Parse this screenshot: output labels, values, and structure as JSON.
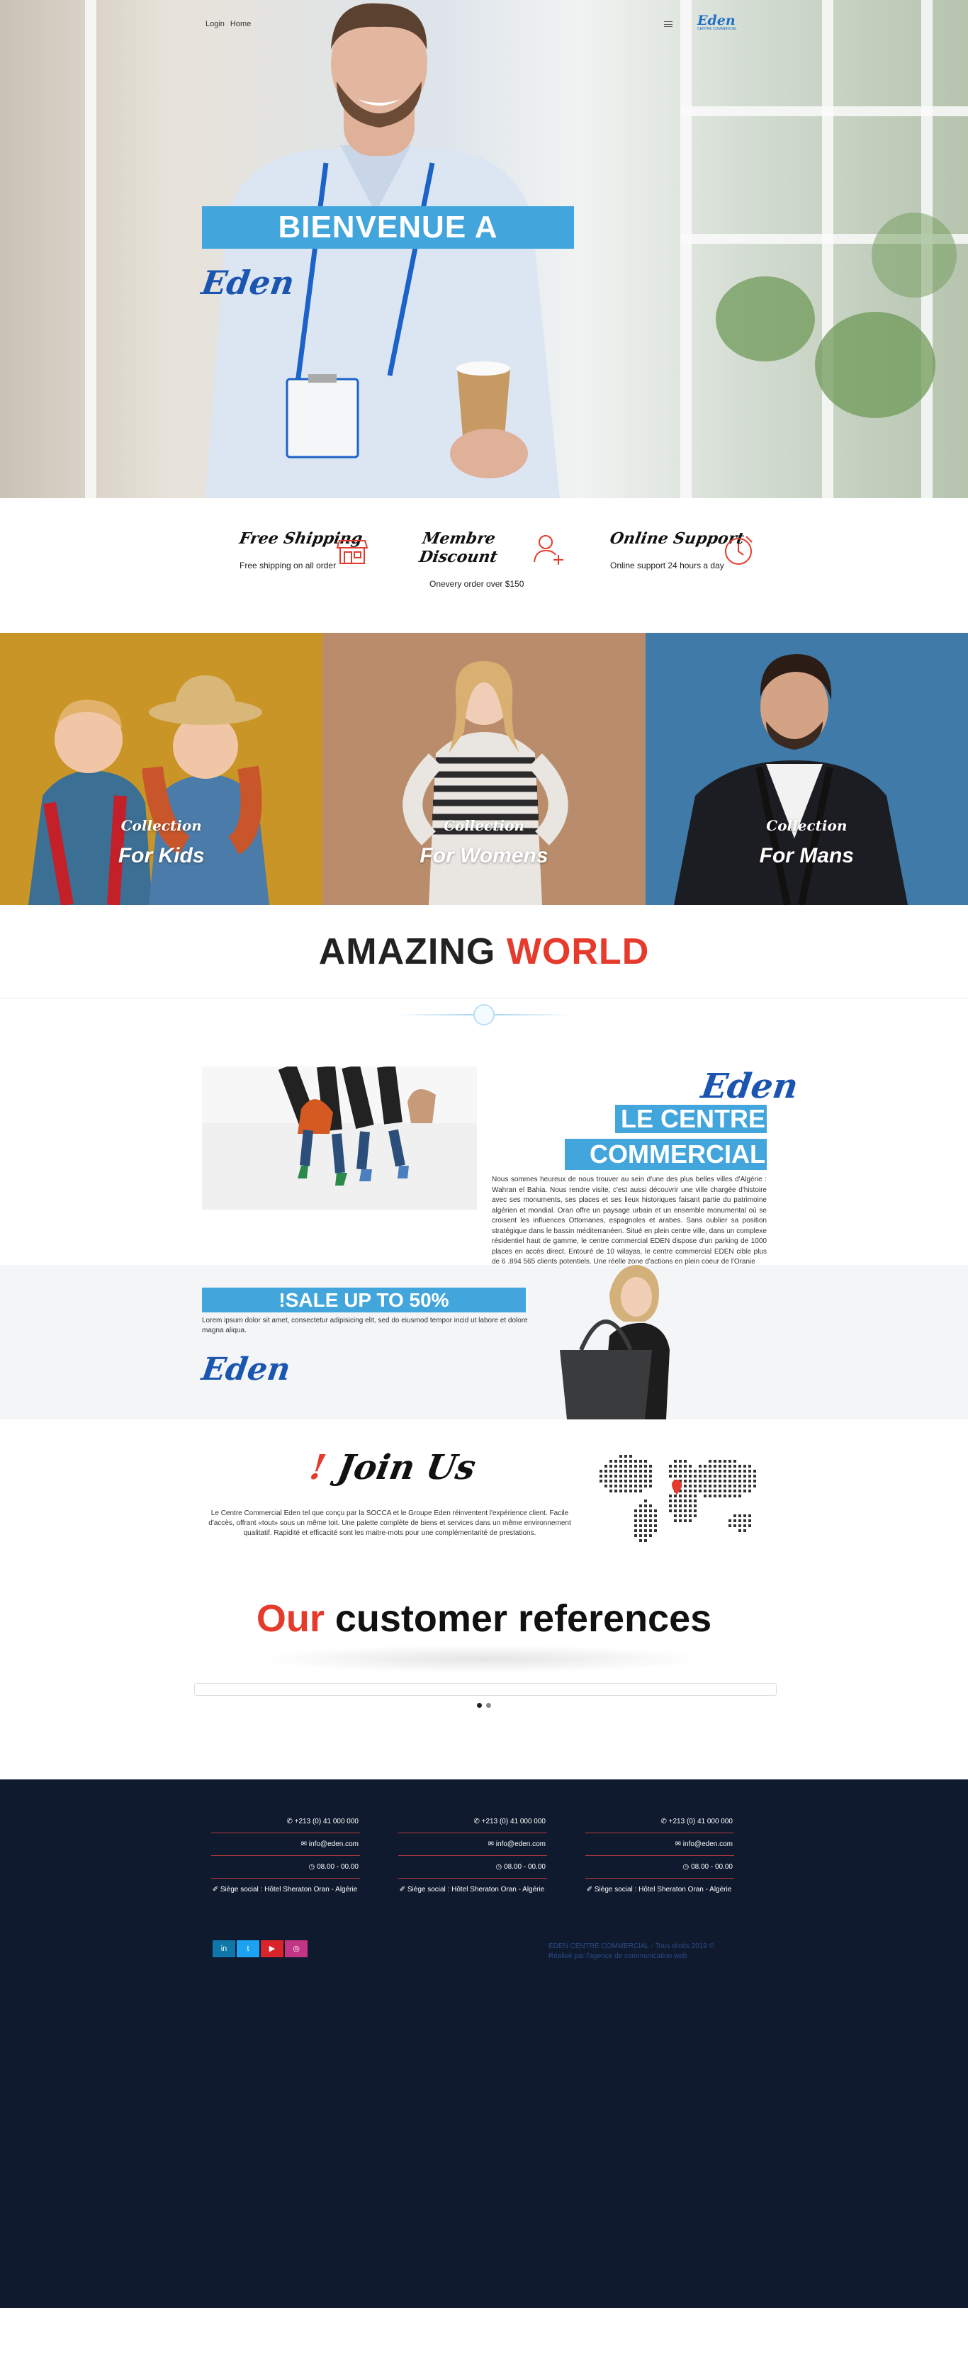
{
  "nav": {
    "login": "Login",
    "home": "Home",
    "logo_word": "Eden",
    "logo_tagline": "CENTRE COMMERCIAL"
  },
  "hero": {
    "banner": "BIENVENUE A",
    "brand": "Eden"
  },
  "features": [
    {
      "title": "Free Shipping",
      "desc": "Free shipping on all order",
      "icon": "shop-icon"
    },
    {
      "title": "Membre Discount",
      "desc": "Onevery order over $150",
      "icon": "user-plus-icon"
    },
    {
      "title": "Online Support",
      "desc": "Online support 24 hours a day",
      "icon": "clock-icon"
    }
  ],
  "collections": [
    {
      "label": "Collection",
      "name": "For Kids",
      "color": "#c99527"
    },
    {
      "label": "Collection",
      "name": "For Womens",
      "color": "#b98d6b"
    },
    {
      "label": "Collection",
      "name": "For Mans",
      "color": "#3f7aa8"
    }
  ],
  "amazing": {
    "part1": "AMAZING",
    "part2": "WORLD"
  },
  "about": {
    "brand": "Eden",
    "line1": "LE CENTRE",
    "line2": "COMMERCIAL",
    "text": "Nous sommes heureux de nous trouver au sein d'une des plus belles villes d'Algérie : Wahran el Bahia. Nous rendre visite, c'est aussi découvrir une ville chargée d'histoire avec ses monuments, ses places et ses lieux historiques faisant partie du patrimoine algérien et mondial. Oran offre un paysage urbain et un ensemble monumental où se croisent les influences Ottomanes, espagnoles et arabes. Sans oublier sa position stratégique dans le bassin méditerranéen. Situé en plein centre ville, dans un complexe résidentiel haut de gamme, le centre commercial EDEN dispose d'un parking de 1000 places en accès direct. Entouré de 10 wilayas, le centre commercial EDEN cible plus de 6 .894 565 clients potentiels. Une réelle zone d'actions en plein coeur de l'Oranie"
  },
  "sale": {
    "banner": "!SALE UP TO 50%",
    "text": "Lorem ipsum dolor sit amet, consectetur adipisicing elit, sed do eiusmod tempor incid ut labore et dolore magna aliqua.",
    "brand": "Eden"
  },
  "join": {
    "mark": "!",
    "title": "Join Us",
    "text": "Le Centre Commercial Eden tel que conçu par la SOCCA et le Groupe Eden réinventent l'expérience client. Facile d'accès, offrant «tout» sous un même toit. Une palette complète de biens et services dans un même environnement qualitatif. Rapidité et efficacité sont les maitre-mots pour une complémentarité de prestations."
  },
  "refs": {
    "part1": "Our",
    "part2": "customer references"
  },
  "footer": {
    "columns": [
      {
        "phone": "+213 (0) 41 000 000",
        "email": "info@eden.com",
        "hours": "08.00 - 00.00",
        "address": "Siège social : Hôtel Sheraton Oran - Algérie"
      },
      {
        "phone": "+213 (0) 41 000 000",
        "email": "info@eden.com",
        "hours": "08.00 - 00.00",
        "address": "Siège social : Hôtel Sheraton Oran - Algérie"
      },
      {
        "phone": "+213 (0) 41 000 000",
        "email": "info@eden.com",
        "hours": "08.00 - 00.00",
        "address": "Siège social : Hôtel Sheraton Oran - Algérie"
      }
    ],
    "social": [
      {
        "icon": "linkedin-icon",
        "glyph": "in",
        "color": "#0e76a8"
      },
      {
        "icon": "twitter-icon",
        "glyph": "t",
        "color": "#1da1f2"
      },
      {
        "icon": "youtube-icon",
        "glyph": "▶",
        "color": "#d9252a"
      },
      {
        "icon": "instagram-icon",
        "glyph": "◎",
        "color": "#c13584"
      }
    ],
    "copyright": "EDEN CENTRE COMMERCIAL - Tous droits 2019 ©",
    "credit": "Réalisé par l'agence de communication web"
  },
  "colors": {
    "accent": "#42a6dd",
    "brand_blue": "#1a55b0",
    "red": "#e53a2c",
    "footer_bg": "#0f1a2e"
  }
}
